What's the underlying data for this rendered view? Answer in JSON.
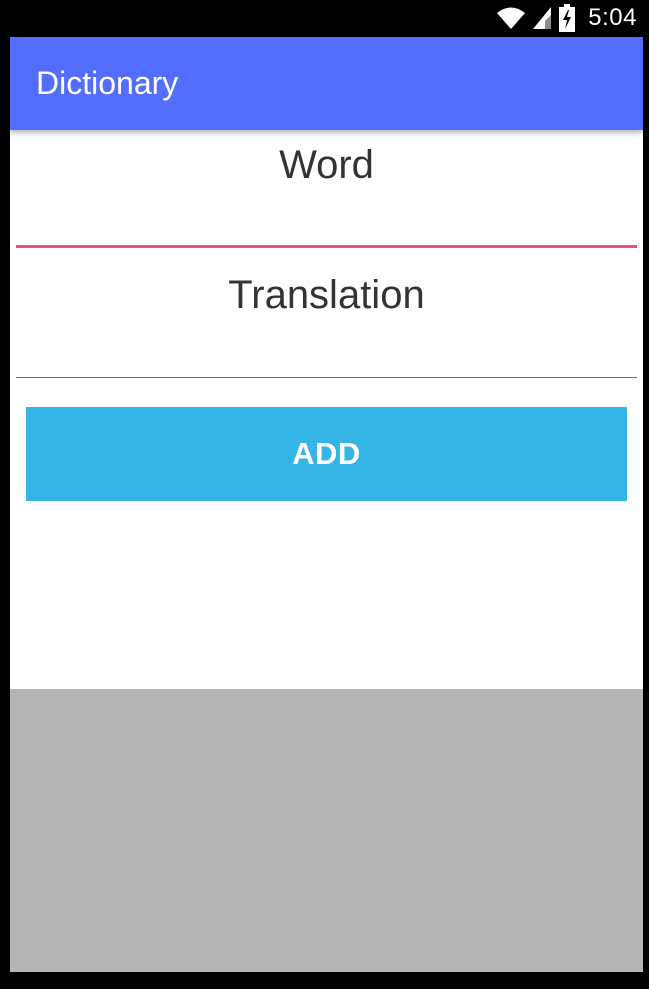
{
  "status_bar": {
    "time": "5:04",
    "icons": [
      "wifi-icon",
      "signal-icon",
      "battery-charging-icon"
    ]
  },
  "app_bar": {
    "title": "Dictionary",
    "color": "#536dfe"
  },
  "form": {
    "word_placeholder": "Word",
    "word_value": "",
    "translation_placeholder": "Translation",
    "translation_value": "",
    "focused_underline_color": "#ee4d7e",
    "add_button_label": "ADD",
    "add_button_color": "#35b5e5"
  },
  "overlay": {
    "color": "#b5b5b5"
  }
}
